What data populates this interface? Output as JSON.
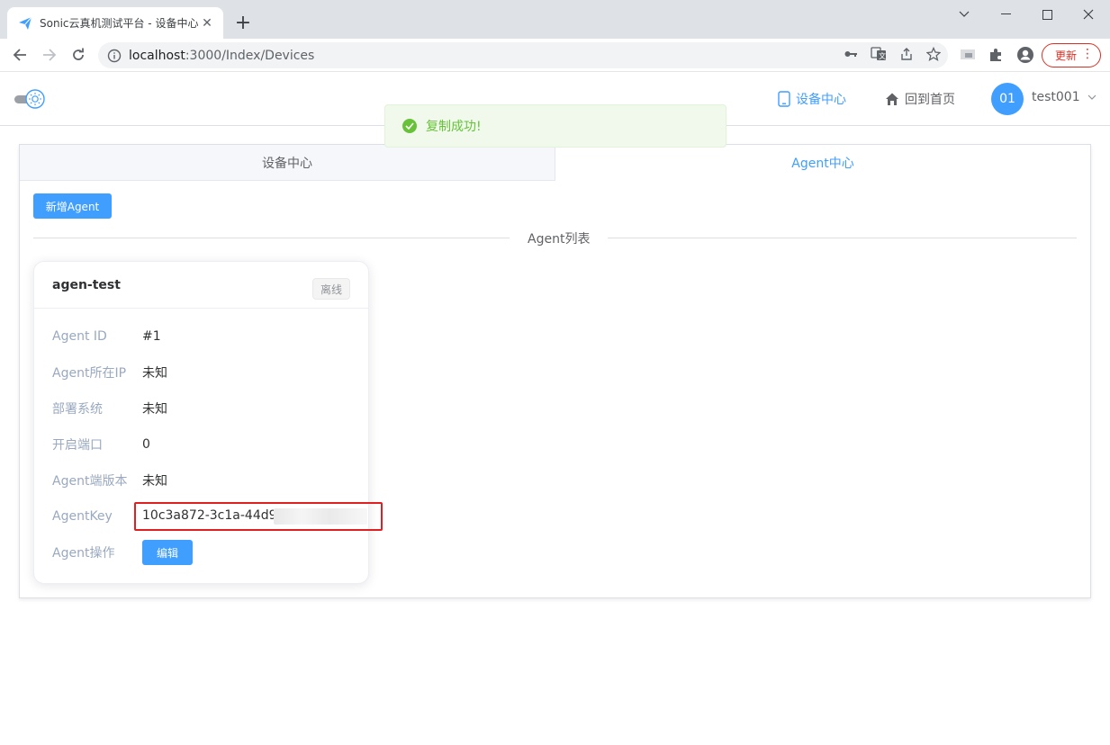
{
  "browser": {
    "tab_title": "Sonic云真机测试平台 - 设备中心",
    "url_host": "localhost",
    "url_rest": ":3000/Index/Devices",
    "update_label": "更新"
  },
  "header": {
    "nav_devices": "设备中心",
    "nav_home": "回到首页",
    "avatar_text": "01",
    "username": "test001"
  },
  "toast": {
    "message": "复制成功!"
  },
  "tabs": [
    {
      "label": "设备中心"
    },
    {
      "label": "Agent中心"
    }
  ],
  "toolbar": {
    "add_agent_label": "新增Agent"
  },
  "section": {
    "divider_label": "Agent列表"
  },
  "agent": {
    "name": "agen-test",
    "status": "离线",
    "rows": [
      {
        "label": "Agent ID",
        "value": "#1"
      },
      {
        "label": "Agent所在IP",
        "value": "未知"
      },
      {
        "label": "部署系统",
        "value": "未知"
      },
      {
        "label": "开启端口",
        "value": "0"
      },
      {
        "label": "Agent端版本",
        "value": "未知"
      },
      {
        "label": "AgentKey",
        "value": "10c3a872-3c1a-44d9-"
      },
      {
        "label": "Agent操作",
        "value": ""
      }
    ],
    "edit_label": "编辑"
  },
  "colors": {
    "primary": "#409eff",
    "success": "#67c23a",
    "highlight_box": "#e02020"
  }
}
